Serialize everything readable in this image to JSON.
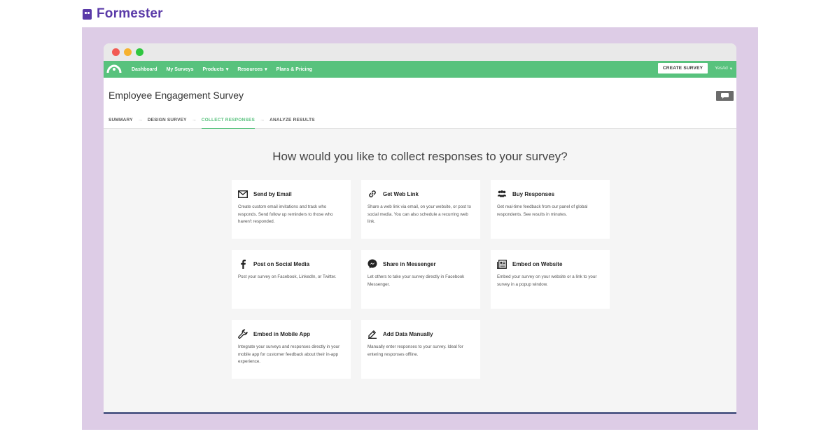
{
  "brand": {
    "name": "Formester"
  },
  "nav": {
    "items": [
      {
        "label": "Dashboard",
        "dropdown": false
      },
      {
        "label": "My Surveys",
        "dropdown": false
      },
      {
        "label": "Products",
        "dropdown": true
      },
      {
        "label": "Resources",
        "dropdown": true
      },
      {
        "label": "Plans & Pricing",
        "dropdown": false
      }
    ],
    "create_label": "CREATE SURVEY",
    "user_label": "YesAd"
  },
  "survey": {
    "title": "Employee Engagement Survey"
  },
  "steps": [
    {
      "label": "SUMMARY",
      "active": false
    },
    {
      "label": "DESIGN SURVEY",
      "active": false
    },
    {
      "label": "COLLECT RESPONSES",
      "active": true
    },
    {
      "label": "ANALYZE RESULTS",
      "active": false
    }
  ],
  "question": "How would you like to collect responses to your survey?",
  "cards": [
    {
      "icon": "email-icon",
      "title": "Send by Email",
      "desc": "Create custom email invitations and track who responds. Send follow up reminders to those who haven't responded."
    },
    {
      "icon": "link-icon",
      "title": "Get Web Link",
      "desc": "Share a web link via email, on your website, or post to social media. You can also schedule a recurring web link."
    },
    {
      "icon": "people-icon",
      "title": "Buy Responses",
      "desc": "Get real-time feedback from our panel of global respondents. See results in minutes."
    },
    {
      "icon": "facebook-icon",
      "title": "Post on Social Media",
      "desc": "Post your survey on Facebook, LinkedIn, or Twitter."
    },
    {
      "icon": "messenger-icon",
      "title": "Share in Messenger",
      "desc": "Let others to take your survey directly in Facebook Messenger."
    },
    {
      "icon": "embed-icon",
      "title": "Embed on Website",
      "desc": "Embed your survey on your website or a link to your survey in a popup window."
    },
    {
      "icon": "wrench-icon",
      "title": "Embed in Mobile App",
      "desc": "Integrate your surveys and responses directly in your mobile app for customer feedback about their in-app experience."
    },
    {
      "icon": "pencil-icon",
      "title": "Add Data Manually",
      "desc": "Manually enter responses to your survey. Ideal for entering responses offline."
    }
  ],
  "colors": {
    "brand": "#5a3aa8",
    "nav": "#58c27d",
    "frame": "#ddcce6"
  }
}
